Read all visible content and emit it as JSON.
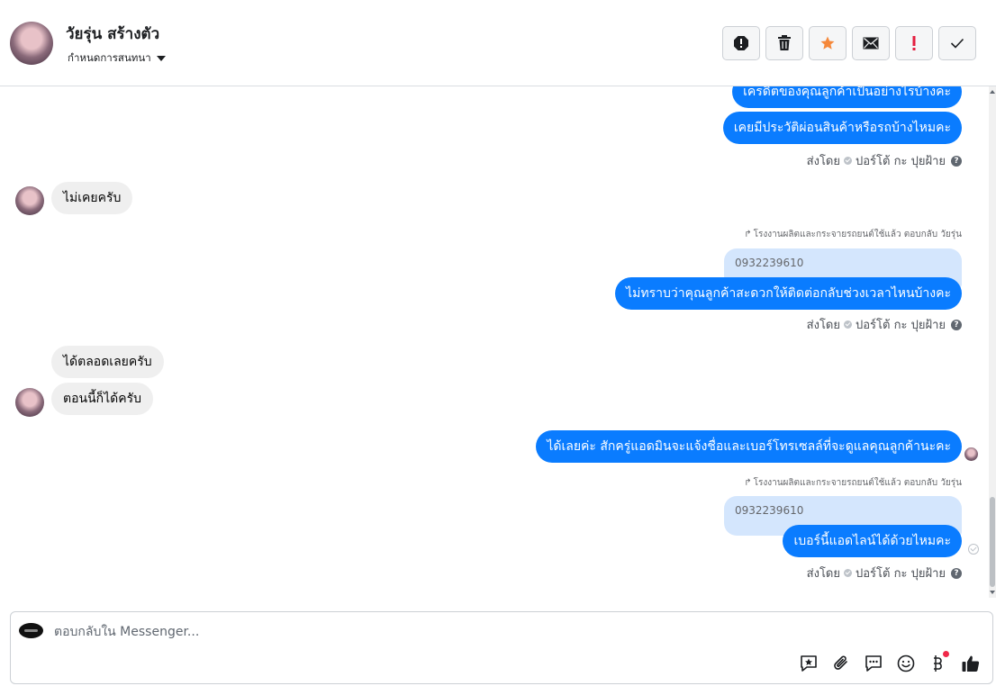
{
  "header": {
    "contact_name": "วัยรุ่น สร้างตัว",
    "assign_label": "กำหนดการสนทนา",
    "toolbar_icons": [
      "spam-icon",
      "trash-icon",
      "star-icon",
      "envelope-icon",
      "exclamation-icon",
      "check-icon"
    ],
    "star_color": "#f5883a",
    "exclamation_color": "#e41e3f"
  },
  "messages": {
    "out_1": "เครดิตของคุณลูกค้าเป็นอย่างไรบ้างคะ",
    "out_2": "เคยมีประวัติผ่อนสินค้าหรือรถบ้างไหมคะ",
    "sent_by_1_label": "ส่งโดย",
    "sent_by_1_name": "ปอร์โต้ กะ ปุยฝ้าย",
    "in_1": "ไม่เคยครับ",
    "reply_meta_1": "โรงงานผลิตและกระจายรถยนต์ใช้แล้ว ตอบกลับ วัยรุ่น",
    "quoted_1": "0932239610",
    "out_3": "ไม่ทราบว่าคุณลูกค้าสะดวกให้ติดต่อกลับช่วงเวลาไหนบ้างคะ",
    "sent_by_2_label": "ส่งโดย",
    "sent_by_2_name": "ปอร์โต้ กะ ปุยฝ้าย",
    "in_2": "ได้ตลอดเลยครับ",
    "in_3": "ตอนนี้ก็ได้ครับ",
    "out_4": "ได้เลยค่ะ สักครู่แอดมินจะแจ้งชื่อและเบอร์โทรเซลล์ที่จะดูแลคุณลูกค้านะคะ",
    "reply_meta_2": "โรงงานผลิตและกระจายรถยนต์ใช้แล้ว ตอบกลับ วัยรุ่น",
    "quoted_2": "0932239610",
    "out_5": "เบอร์นี้แอดไลน์ได้ด้วยไหมคะ",
    "sent_by_3_label": "ส่งโดย",
    "sent_by_3_name": "ปอร์โต้ กะ ปุยฝ้าย"
  },
  "composer": {
    "placeholder": "ตอบกลับใน Messenger...",
    "tools": [
      "saved-reply-icon",
      "attachment-icon",
      "chat-bubble-icon",
      "emoji-icon",
      "baht-icon",
      "thumbs-up-icon"
    ]
  },
  "colors": {
    "outgoing_bubble": "#0a7cff",
    "incoming_bubble": "#efefef",
    "quoted_bubble": "#d4e6fd"
  }
}
